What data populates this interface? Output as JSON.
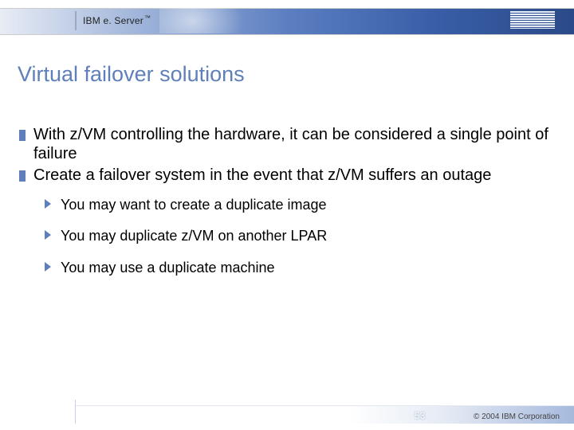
{
  "header": {
    "brand_prefix": "IBM e. Server",
    "brand_tm": "™"
  },
  "title": "Virtual failover solutions",
  "bullets": [
    "With z/VM controlling the hardware, it can be considered a single point of failure",
    "Create a failover system in the event that z/VM suffers an outage"
  ],
  "sub_bullets": [
    "You may want to create a duplicate image",
    "You may duplicate z/VM on another LPAR",
    "You may use a duplicate machine"
  ],
  "footer": {
    "page_number": "53",
    "copyright": "© 2004 IBM Corporation"
  }
}
